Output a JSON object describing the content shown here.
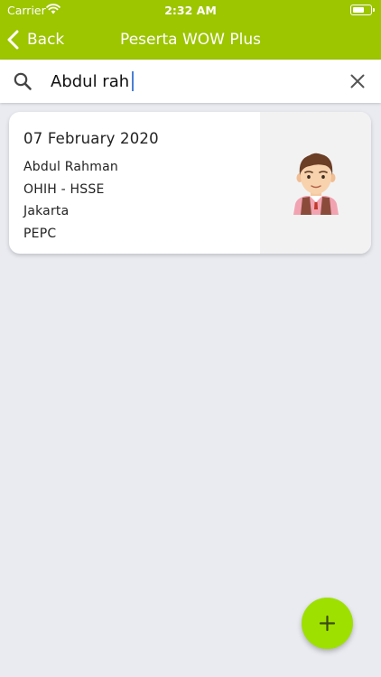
{
  "status_bar": {
    "carrier": "Carrier",
    "time": "2:32 AM",
    "icons": [
      "wifi-icon",
      "battery-icon"
    ]
  },
  "navbar": {
    "back_label": "Back",
    "title": "Peserta WOW Plus"
  },
  "search": {
    "value": "Abdul rah",
    "icons": [
      "search-icon",
      "clear-icon"
    ]
  },
  "results": [
    {
      "date": "07 February 2020",
      "name": "Abdul Rahman",
      "unit": "OHIH - HSSE",
      "location": "Jakarta",
      "company": "PEPC",
      "photo_icon": "avatar-icon"
    }
  ],
  "fab": {
    "icon": "plus-icon"
  },
  "colors": {
    "brand_green": "#9dc500",
    "fab_green": "#9ee000",
    "background": "#e9ebf1"
  }
}
